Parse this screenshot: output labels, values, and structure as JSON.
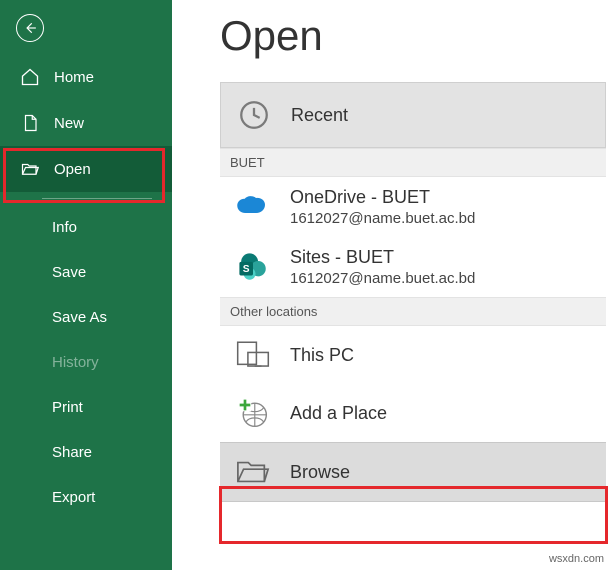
{
  "sidebar": {
    "items": [
      {
        "label": "Home"
      },
      {
        "label": "New"
      },
      {
        "label": "Open"
      }
    ],
    "sub_items": [
      {
        "label": "Info"
      },
      {
        "label": "Save"
      },
      {
        "label": "Save As"
      },
      {
        "label": "History",
        "disabled": true
      },
      {
        "label": "Print"
      },
      {
        "label": "Share"
      },
      {
        "label": "Export"
      }
    ]
  },
  "page": {
    "title": "Open"
  },
  "locations": {
    "recent": {
      "label": "Recent"
    },
    "section1": "BUET",
    "onedrive": {
      "title": "OneDrive - BUET",
      "sub": "1612027@name.buet.ac.bd"
    },
    "sites": {
      "title": "Sites - BUET",
      "sub": "1612027@name.buet.ac.bd"
    },
    "section2": "Other locations",
    "thispc": {
      "title": "This PC"
    },
    "addplace": {
      "title": "Add a Place"
    },
    "browse": {
      "title": "Browse"
    }
  },
  "watermark": "wsxdn.com"
}
